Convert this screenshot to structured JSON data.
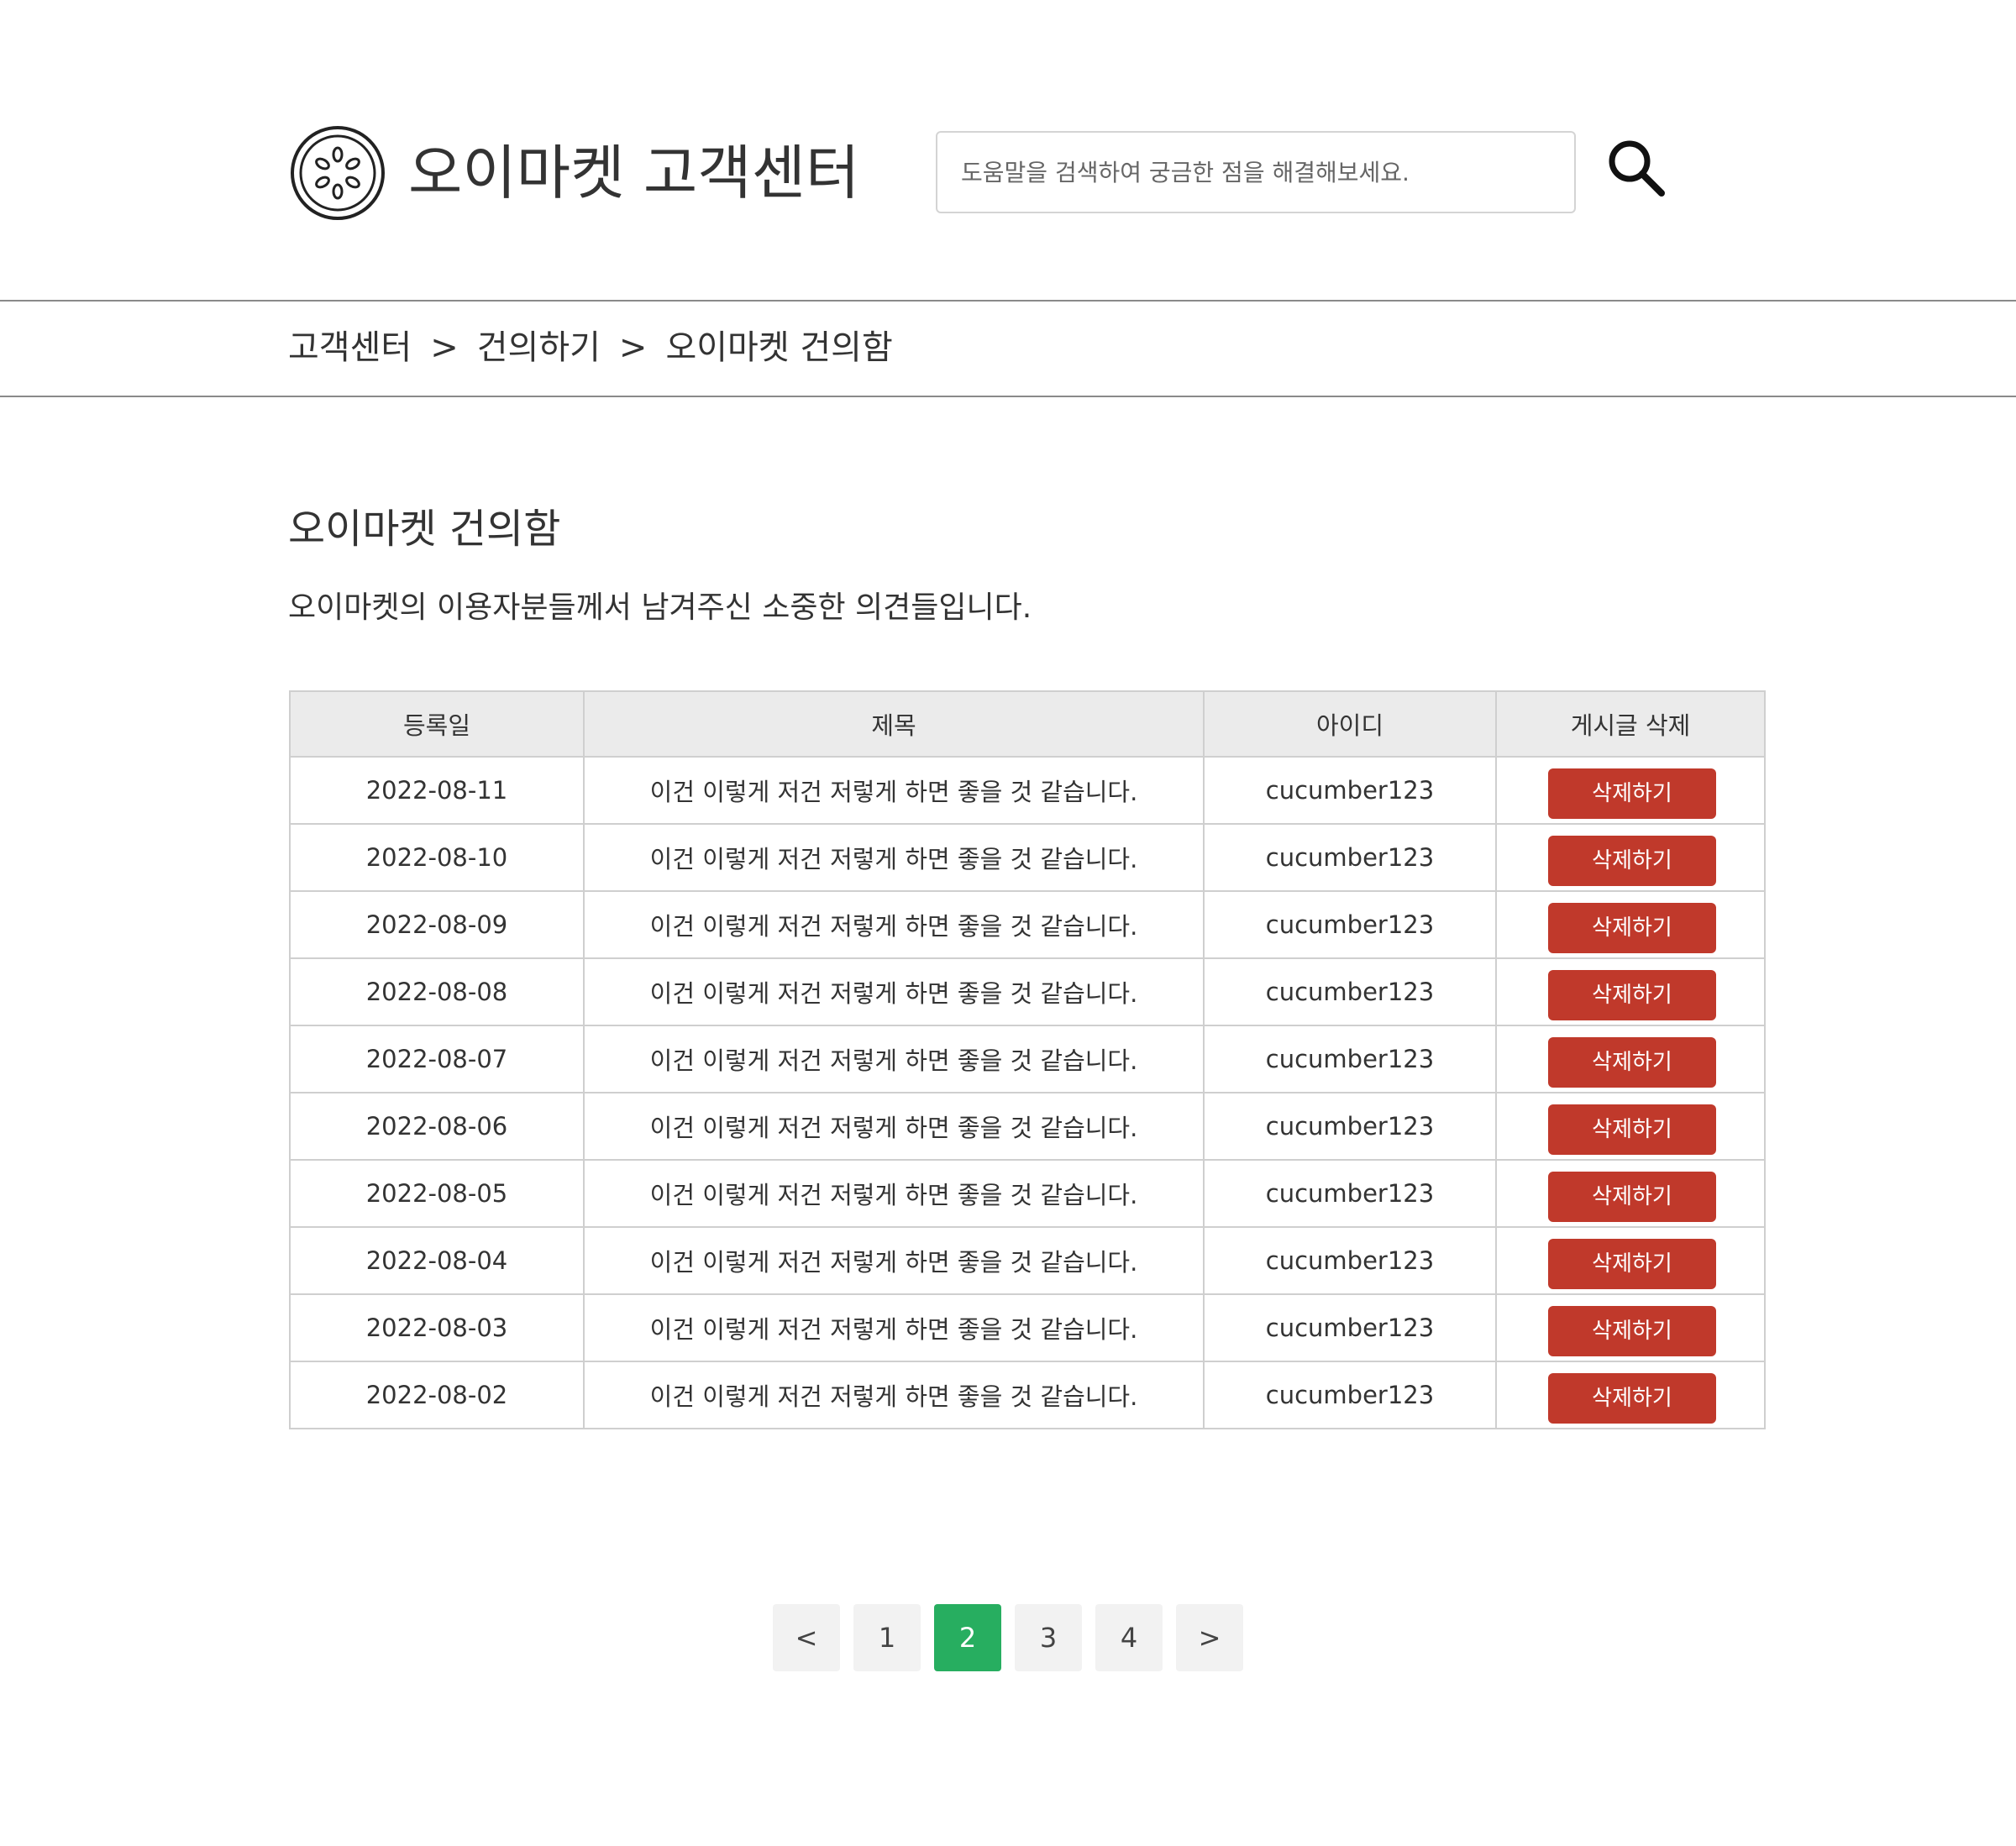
{
  "header": {
    "logo_icon": "cucumber-slice-icon",
    "title": "오이마켓 고객센터",
    "search_placeholder": "도움말을 검색하여 궁금한 점을 해결해보세요.",
    "search_icon": "search-icon"
  },
  "breadcrumb": {
    "items": [
      "고객센터",
      "건의하기",
      "오이마켓 건의함"
    ],
    "separator": ">"
  },
  "main": {
    "title": "오이마켓 건의함",
    "description": "오이마켓의 이용자분들께서 남겨주신 소중한 의견들입니다."
  },
  "table": {
    "headers": [
      "등록일",
      "제목",
      "아이디",
      "게시글 삭제"
    ],
    "delete_label": "삭제하기",
    "rows": [
      {
        "date": "2022-08-11",
        "title": "이건 이렇게 저건 저렇게 하면 좋을 것 같습니다.",
        "user_id": "cucumber123"
      },
      {
        "date": "2022-08-10",
        "title": "이건 이렇게 저건 저렇게 하면 좋을 것 같습니다.",
        "user_id": "cucumber123"
      },
      {
        "date": "2022-08-09",
        "title": "이건 이렇게 저건 저렇게 하면 좋을 것 같습니다.",
        "user_id": "cucumber123"
      },
      {
        "date": "2022-08-08",
        "title": "이건 이렇게 저건 저렇게 하면 좋을 것 같습니다.",
        "user_id": "cucumber123"
      },
      {
        "date": "2022-08-07",
        "title": "이건 이렇게 저건 저렇게 하면 좋을 것 같습니다.",
        "user_id": "cucumber123"
      },
      {
        "date": "2022-08-06",
        "title": "이건 이렇게 저건 저렇게 하면 좋을 것 같습니다.",
        "user_id": "cucumber123"
      },
      {
        "date": "2022-08-05",
        "title": "이건 이렇게 저건 저렇게 하면 좋을 것 같습니다.",
        "user_id": "cucumber123"
      },
      {
        "date": "2022-08-04",
        "title": "이건 이렇게 저건 저렇게 하면 좋을 것 같습니다.",
        "user_id": "cucumber123"
      },
      {
        "date": "2022-08-03",
        "title": "이건 이렇게 저건 저렇게 하면 좋을 것 같습니다.",
        "user_id": "cucumber123"
      },
      {
        "date": "2022-08-02",
        "title": "이건 이렇게 저건 저렇게 하면 좋을 것 같습니다.",
        "user_id": "cucumber123"
      }
    ]
  },
  "pagination": {
    "prev_label": "<",
    "next_label": ">",
    "pages": [
      "1",
      "2",
      "3",
      "4"
    ],
    "current_page": "2"
  },
  "colors": {
    "delete_button": "#c0392b",
    "active_page": "#27ae60",
    "table_header_bg": "#ebebeb",
    "text": "#333333"
  }
}
